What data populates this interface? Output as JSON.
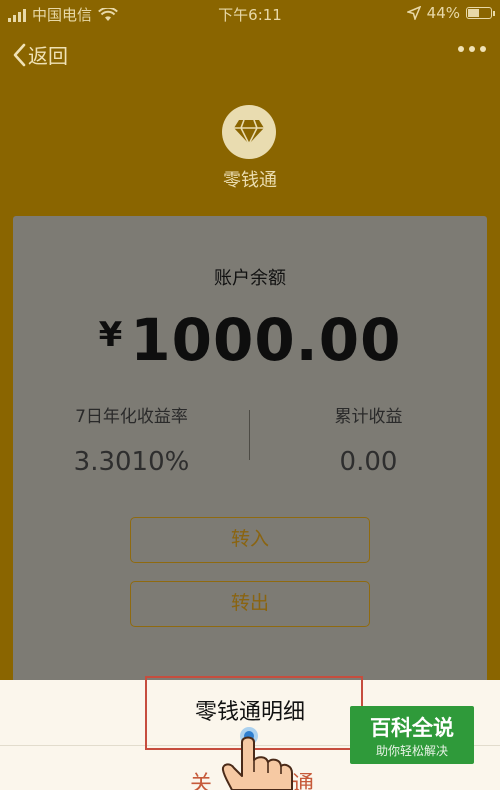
{
  "status_bar": {
    "carrier": "中国电信",
    "time": "下午6:11",
    "battery_text": "44%",
    "battery_level": 0.44
  },
  "nav": {
    "back_label": "返回",
    "back_icon": "chevron-left-icon",
    "more_icon": "more-dots-icon"
  },
  "brand": {
    "icon": "diamond-icon",
    "name": "零钱通"
  },
  "account": {
    "title": "账户余额",
    "currency_symbol": "¥",
    "balance": "1000.00",
    "stats": [
      {
        "label": "7日年化收益率",
        "value": "3.3010%"
      },
      {
        "label": "累计收益",
        "value": "0.00"
      }
    ],
    "buttons": {
      "transfer_in": "转入",
      "transfer_out": "转出"
    }
  },
  "sheet": {
    "detail_label": "零钱通明细",
    "close_partial_head": "关",
    "close_partial_tail": "通"
  },
  "watermark": {
    "title": "百科全说",
    "subtitle": "助你轻松解决"
  },
  "colors": {
    "backdrop": "#8a6500",
    "card": "#7d7b74",
    "accent": "#8a6410",
    "highlight": "#c64d3e",
    "watermark": "#2f9a3a"
  }
}
